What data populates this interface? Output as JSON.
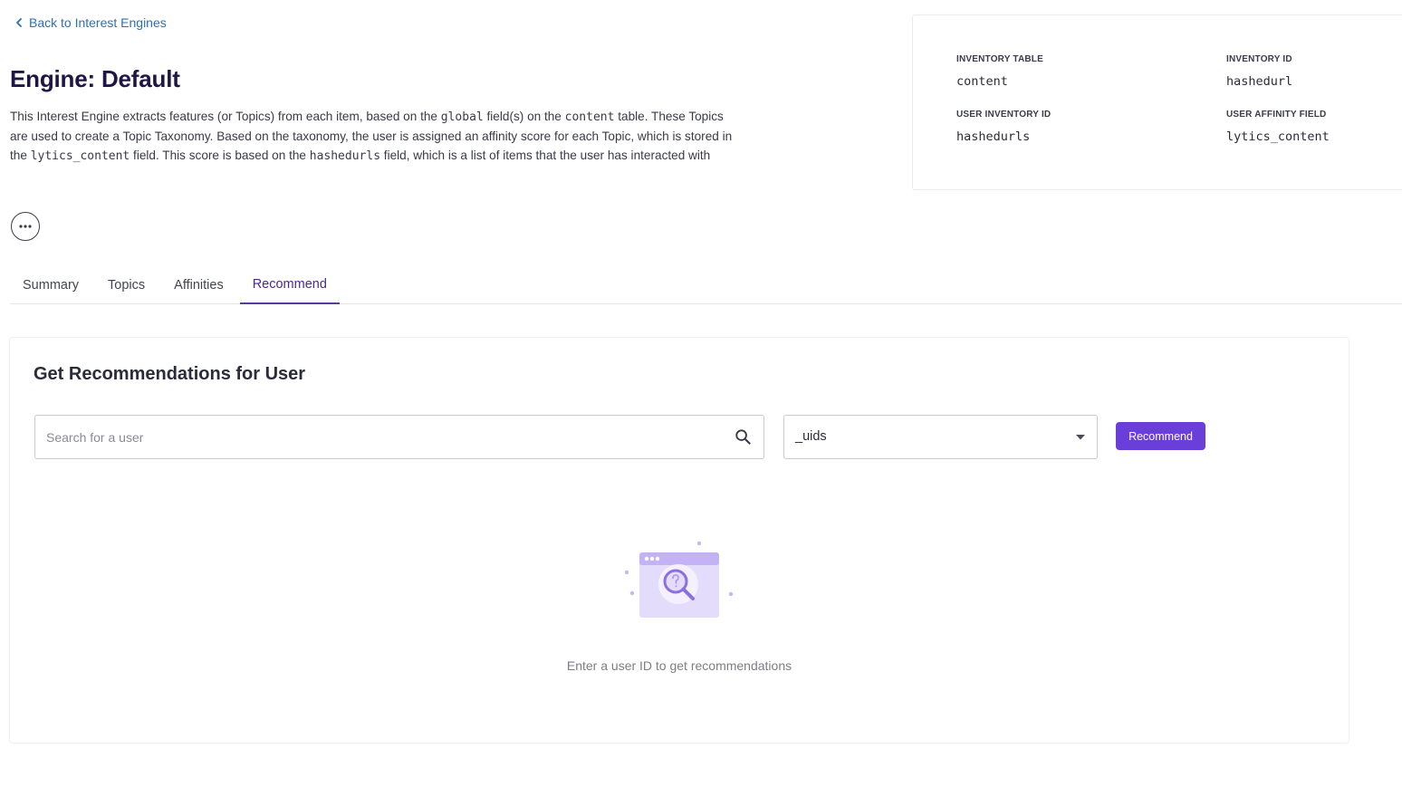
{
  "nav": {
    "back_label": "Back to Interest Engines"
  },
  "engine": {
    "title": "Engine: Default",
    "description": {
      "p1": "This Interest Engine extracts features (or Topics) from each item, based on the ",
      "code1": "global",
      "p2": " field(s) on the ",
      "code2": "content",
      "p3": " table. These Topics are used to create a Topic Taxonomy. Based on the taxonomy, the user is assigned an affinity score for each Topic, which is stored in the ",
      "code3": "lytics_content",
      "p4": " field. This score is based on the ",
      "code4": "hashedurls",
      "p5": " field, which is a list of items that the user has interacted with"
    }
  },
  "info": {
    "inventory_table": {
      "label": "INVENTORY TABLE",
      "value": "content"
    },
    "inventory_id": {
      "label": "INVENTORY ID",
      "value": "hashedurl"
    },
    "user_inventory_id": {
      "label": "USER INVENTORY ID",
      "value": "hashedurls"
    },
    "user_affinity_field": {
      "label": "USER AFFINITY FIELD",
      "value": "lytics_content"
    }
  },
  "tabs": [
    {
      "label": "Summary",
      "active": false
    },
    {
      "label": "Topics",
      "active": false
    },
    {
      "label": "Affinities",
      "active": false
    },
    {
      "label": "Recommend",
      "active": true
    }
  ],
  "recommend": {
    "title": "Get Recommendations for User",
    "search_placeholder": "Search for a user",
    "search_value": "",
    "select_value": "_uids",
    "button_label": "Recommend",
    "empty_message": "Enter a user ID to get recommendations"
  },
  "colors": {
    "link": "#2f6fb3",
    "title": "#1f1645",
    "accent": "#6a3fd9",
    "tab_active": "#5b3aa0"
  },
  "icons": {
    "back": "chevron-left-icon",
    "more": "more-horizontal-icon",
    "search": "search-icon",
    "select": "chevron-down-icon",
    "empty": "empty-search-illustration"
  }
}
